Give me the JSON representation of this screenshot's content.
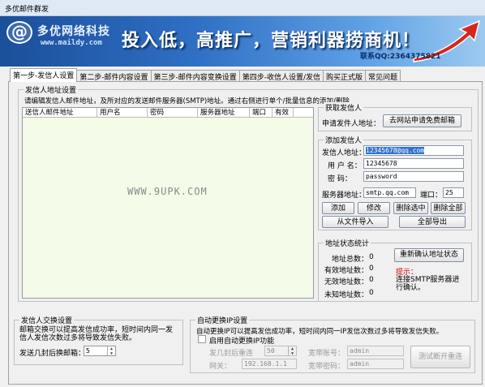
{
  "window": {
    "title": "多优邮件群发"
  },
  "banner": {
    "brand": "多优网络科技",
    "url": "www.maildy.com",
    "slogan": "投入低，高推广，营销利器捞商机！",
    "contact": "联系QQ:2364375821"
  },
  "tabs": [
    {
      "label": "第一步-发信人设置",
      "active": true
    },
    {
      "label": "第二步-邮件内容设置",
      "active": false
    },
    {
      "label": "第三步-邮件内容变换设置",
      "active": false
    },
    {
      "label": "第四步-收信人设置/发信",
      "active": false
    },
    {
      "label": "购买正式版",
      "active": false
    },
    {
      "label": "常见问题",
      "active": false
    }
  ],
  "sender_settings": {
    "legend": "发信人地址设置",
    "description": "请编辑发信人邮件地址，及所对应的发送邮件服务器(SMTP)地址。通过右侧进行单个/批量信息的添加/删除",
    "columns": [
      "送信人邮件地址",
      "用户名",
      "密码",
      "服务器地址",
      "端口",
      "有效"
    ],
    "watermark": "WWW.9UPK.COM"
  },
  "get_sender": {
    "legend": "获取发信人",
    "label": "申请发件人地址：",
    "button": "去网站申请免费邮箱"
  },
  "add_sender": {
    "legend": "添加发信人",
    "address_label": "发信人地址：",
    "address_value": "12345678@qq.com",
    "user_label": "用 户 名：",
    "user_value": "12345678",
    "password_label": "密    码：",
    "password_value": "password",
    "server_label": "服务器地址：",
    "server_value": "smtp.qq.com",
    "port_label": "端口：",
    "port_value": "25",
    "add_button": "添加",
    "edit_button": "修改",
    "delete_selected_button": "删除选中",
    "delete_all_button": "删除全部",
    "import_button": "从文件导入",
    "export_button": "全部导出"
  },
  "stats": {
    "legend": "地址状态统计",
    "total_label": "地址总数：",
    "total_value": "0",
    "valid_label": "有效地址数：",
    "valid_value": "0",
    "invalid_label": "无效地址数：",
    "invalid_value": "0",
    "unknown_label": "未知地址数：",
    "unknown_value": "0",
    "reconfirm_button": "重新确认地址状态",
    "hint_title": "提示：",
    "hint_text": "连接SMTP服务器进行确认。"
  },
  "sender_swap": {
    "legend": "发信人交换设置",
    "description": "邮箱交换可以提高发信成功率，短时间内同一发信人发信次数过多将导致发信失败。",
    "count_label": "发送几封后换邮箱：",
    "count_value": "5"
  },
  "ip_change": {
    "legend": "自动更换IP设置",
    "description": "自动更换IP可以提高发信成功率，短时间内同一IP发信次数过多将导致发信失败。",
    "enable_label": "启用自动更换IP功能",
    "retry_label": "发几封后重连",
    "retry_value": "50",
    "account_label": "宽带账号：",
    "account_value": "admin",
    "gateway_label": "网关：",
    "gateway_value": "192.168.1.1",
    "password_label": "宽带密码：",
    "password_value": "admin",
    "test_button": "测试断开重连"
  }
}
